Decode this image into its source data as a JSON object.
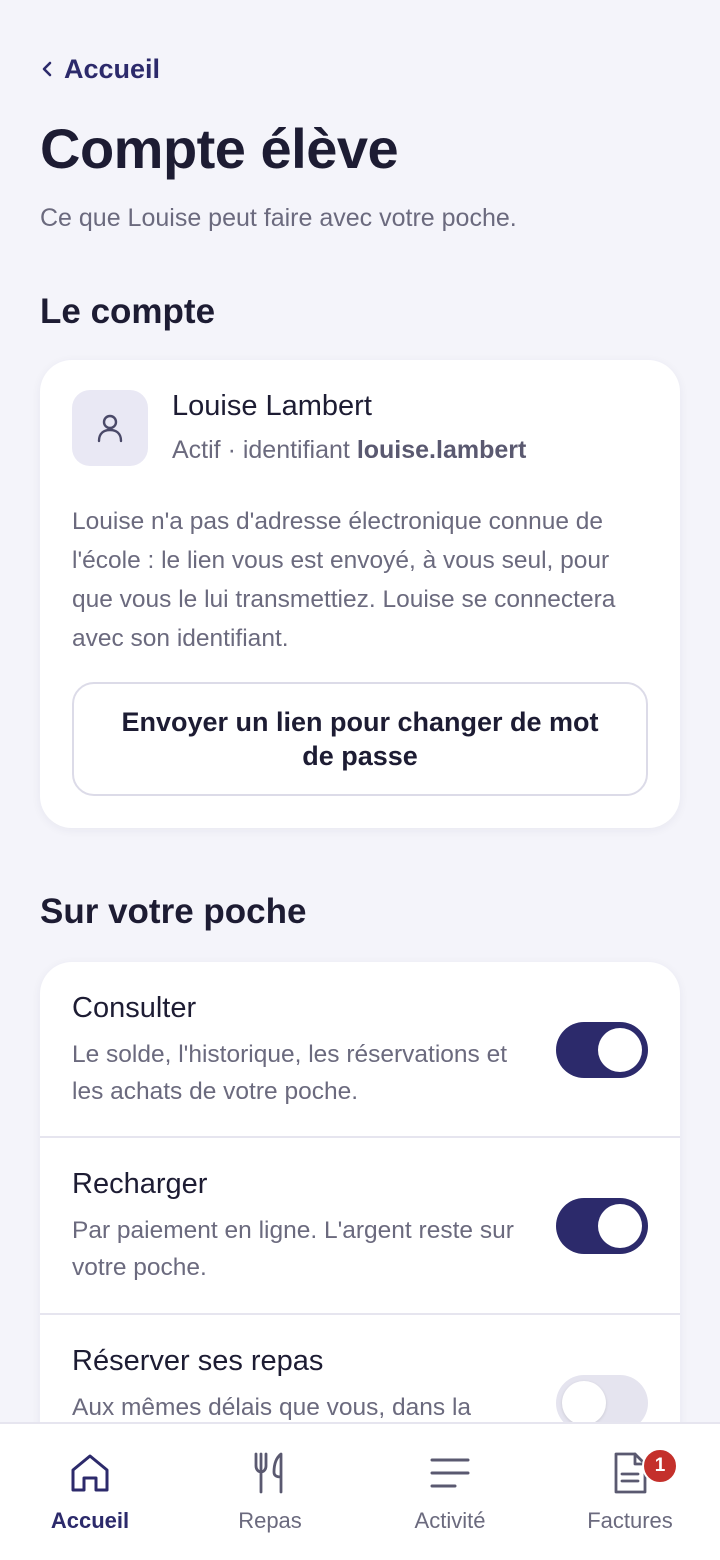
{
  "header": {
    "back_label": "Accueil",
    "title": "Compte élève",
    "subtitle": "Ce que Louise peut faire avec votre poche."
  },
  "account_section": {
    "heading": "Le compte",
    "student_name": "Louise Lambert",
    "status_prefix": "Actif · identifiant ",
    "username": "louise.lambert",
    "note": "Louise n'a pas d'adresse électronique connue de l'école : le lien vous est envoyé, à vous seul, pour que vous le lui transmettiez. Louise se connectera avec son identifiant.",
    "reset_button_label": "Envoyer un lien pour changer de mot de passe",
    "avatar_icon": "user-icon"
  },
  "permissions_section": {
    "heading": "Sur votre poche",
    "items": [
      {
        "label": "Consulter",
        "description": "Le solde, l'historique, les réservations et les achats de votre poche.",
        "enabled": true
      },
      {
        "label": "Recharger",
        "description": "Par paiement en ligne. L'argent reste sur votre poche.",
        "enabled": true
      },
      {
        "label": "Réserver ses repas",
        "description": "Aux mêmes délais que vous, dans la",
        "enabled": false
      }
    ]
  },
  "bottom_nav": {
    "items": [
      {
        "label": "Accueil",
        "icon": "home-icon",
        "active": true
      },
      {
        "label": "Repas",
        "icon": "utensils-icon",
        "active": false
      },
      {
        "label": "Activité",
        "icon": "activity-lines-icon",
        "active": false
      },
      {
        "label": "Factures",
        "icon": "invoice-icon",
        "active": false,
        "badge": "1"
      }
    ]
  },
  "colors": {
    "primary": "#2c2a6b",
    "background": "#f4f4fa",
    "badge": "#c4302b",
    "toggle_off": "#e5e4ef"
  }
}
